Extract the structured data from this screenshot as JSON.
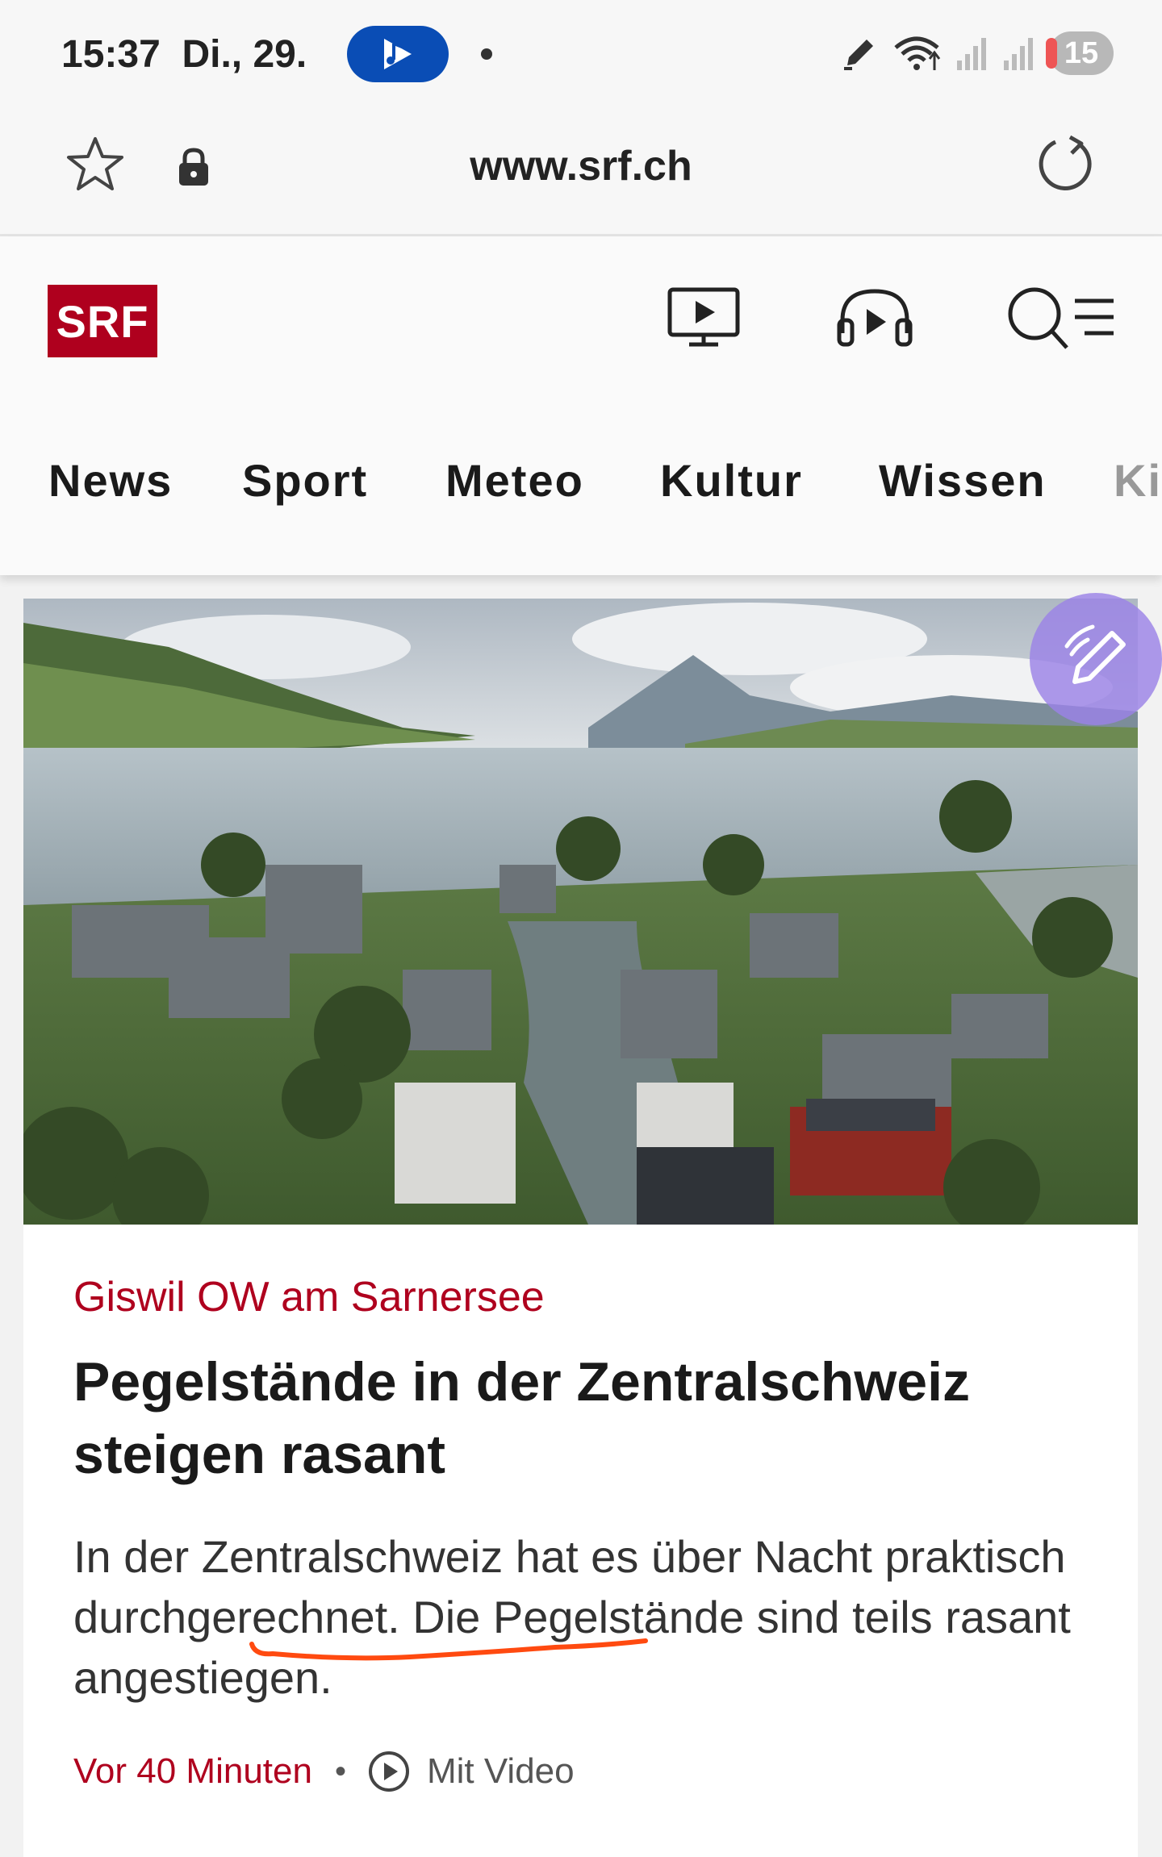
{
  "status_bar": {
    "time": "15:37",
    "date": "Di., 29.",
    "notification_count": "15",
    "icons": [
      "music-app-icon",
      "pen-icon",
      "wifi-icon",
      "signal-icon",
      "signal-icon"
    ]
  },
  "browser": {
    "url": "www.srf.ch"
  },
  "header": {
    "logo": "SRF",
    "nav": [
      "News",
      "Sport",
      "Meteo",
      "Kultur",
      "Wissen",
      "Ki"
    ]
  },
  "article": {
    "kicker": "Giswil OW am Sarnersee",
    "title": "Pegelstände in der Zentralschweiz steigen rasant",
    "lead": "In der Zentralschweiz hat es über Nacht praktisch durchgerechnet. Die Pegelstände sind teils rasant angestiegen.",
    "time": "Vor 40 Minuten",
    "video_label": "Mit Video"
  },
  "colors": {
    "brand_red": "#af001e",
    "pill_blue": "#0a4db5",
    "annotation_orange": "#ff4a10"
  }
}
